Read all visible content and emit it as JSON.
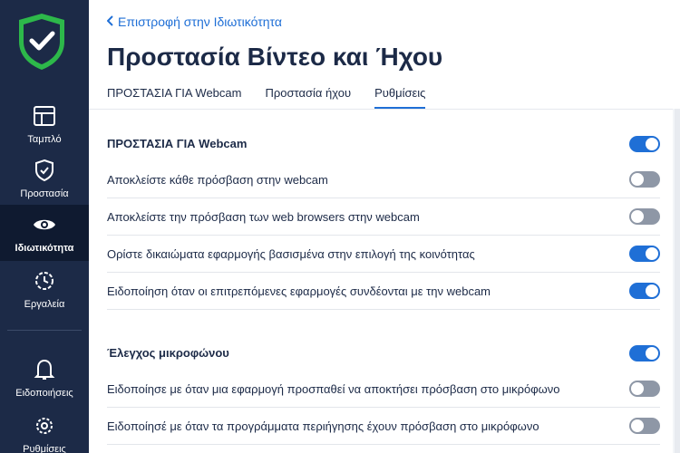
{
  "sidebar": {
    "items": [
      {
        "label": "Ταμπλό",
        "icon": "dashboard-icon"
      },
      {
        "label": "Προστασία",
        "icon": "shield-check-icon"
      },
      {
        "label": "Ιδιωτικότητα",
        "icon": "eye-icon"
      },
      {
        "label": "Εργαλεία",
        "icon": "tools-icon"
      },
      {
        "label": "Ειδοποιήσεις",
        "icon": "bell-icon"
      },
      {
        "label": "Ρυθμίσεις",
        "icon": "gear-icon"
      }
    ],
    "active_index": 2,
    "colors": {
      "background": "#1c2a47",
      "active": "#0f1a30",
      "logo": "#2db84a"
    }
  },
  "header": {
    "back_label": "Επιστροφή στην Ιδιωτικότητα",
    "title": "Προστασία Βίντεο και Ήχου",
    "tabs": [
      {
        "label": "ΠΡΟΣΤΑΣΙΑ ΓΙΑ Webcam",
        "active": false
      },
      {
        "label": "Προστασία ήχου",
        "active": false
      },
      {
        "label": "Ρυθμίσεις",
        "active": true
      }
    ]
  },
  "settings": {
    "webcam": {
      "title": "ΠΡΟΣΤΑΣΙΑ ΓΙΑ Webcam",
      "enabled": true,
      "options": [
        {
          "label": "Αποκλείστε κάθε πρόσβαση στην webcam",
          "enabled": false
        },
        {
          "label": "Αποκλείστε την πρόσβαση των web browsers στην webcam",
          "enabled": false
        },
        {
          "label": "Ορίστε δικαιώματα εφαρμογής βασισμένα στην επιλογή της κοινότητας",
          "enabled": true
        },
        {
          "label": "Ειδοποίηση όταν οι επιτρεπόμενες εφαρμογές συνδέονται με την webcam",
          "enabled": true
        }
      ]
    },
    "microphone": {
      "title": "Έλεγχος μικροφώνου",
      "enabled": true,
      "options": [
        {
          "label": "Ειδοποίησε με όταν μια εφαρμογή προσπαθεί να αποκτήσει πρόσβαση στο μικρόφωνο",
          "enabled": false
        },
        {
          "label": "Ειδοποίησέ με όταν τα προγράμματα περιήγησης έχουν πρόσβαση στο μικρόφωνο",
          "enabled": false
        }
      ]
    }
  },
  "colors": {
    "accent": "#1f6fd6",
    "toggle_off": "#8e97a6",
    "text": "#1c2a47"
  }
}
